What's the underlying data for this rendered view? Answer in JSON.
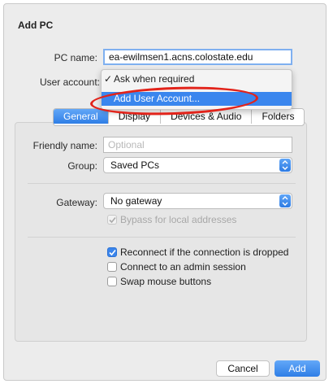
{
  "dialog": {
    "title": "Add PC",
    "pc_name_label": "PC name:",
    "pc_name_value": "ea-ewilmsen1.acns.colostate.edu",
    "user_account_label": "User account:",
    "user_account_menu": {
      "items": [
        {
          "check": "✓",
          "label": "Ask when required"
        },
        {
          "label": "Add User Account..."
        }
      ]
    },
    "tabs": [
      "General",
      "Display",
      "Devices & Audio",
      "Folders"
    ],
    "general": {
      "friendly_name_label": "Friendly name:",
      "friendly_name_placeholder": "Optional",
      "group_label": "Group:",
      "group_value": "Saved PCs",
      "gateway_label": "Gateway:",
      "gateway_value": "No gateway",
      "bypass_label": "Bypass for local addresses",
      "reconnect_label": "Reconnect if the connection is dropped",
      "admin_session_label": "Connect to an admin session",
      "swap_mouse_label": "Swap mouse buttons"
    },
    "buttons": {
      "cancel": "Cancel",
      "add": "Add"
    }
  },
  "colors": {
    "accent": "#2f7ee6",
    "annotation": "#e2231a"
  }
}
